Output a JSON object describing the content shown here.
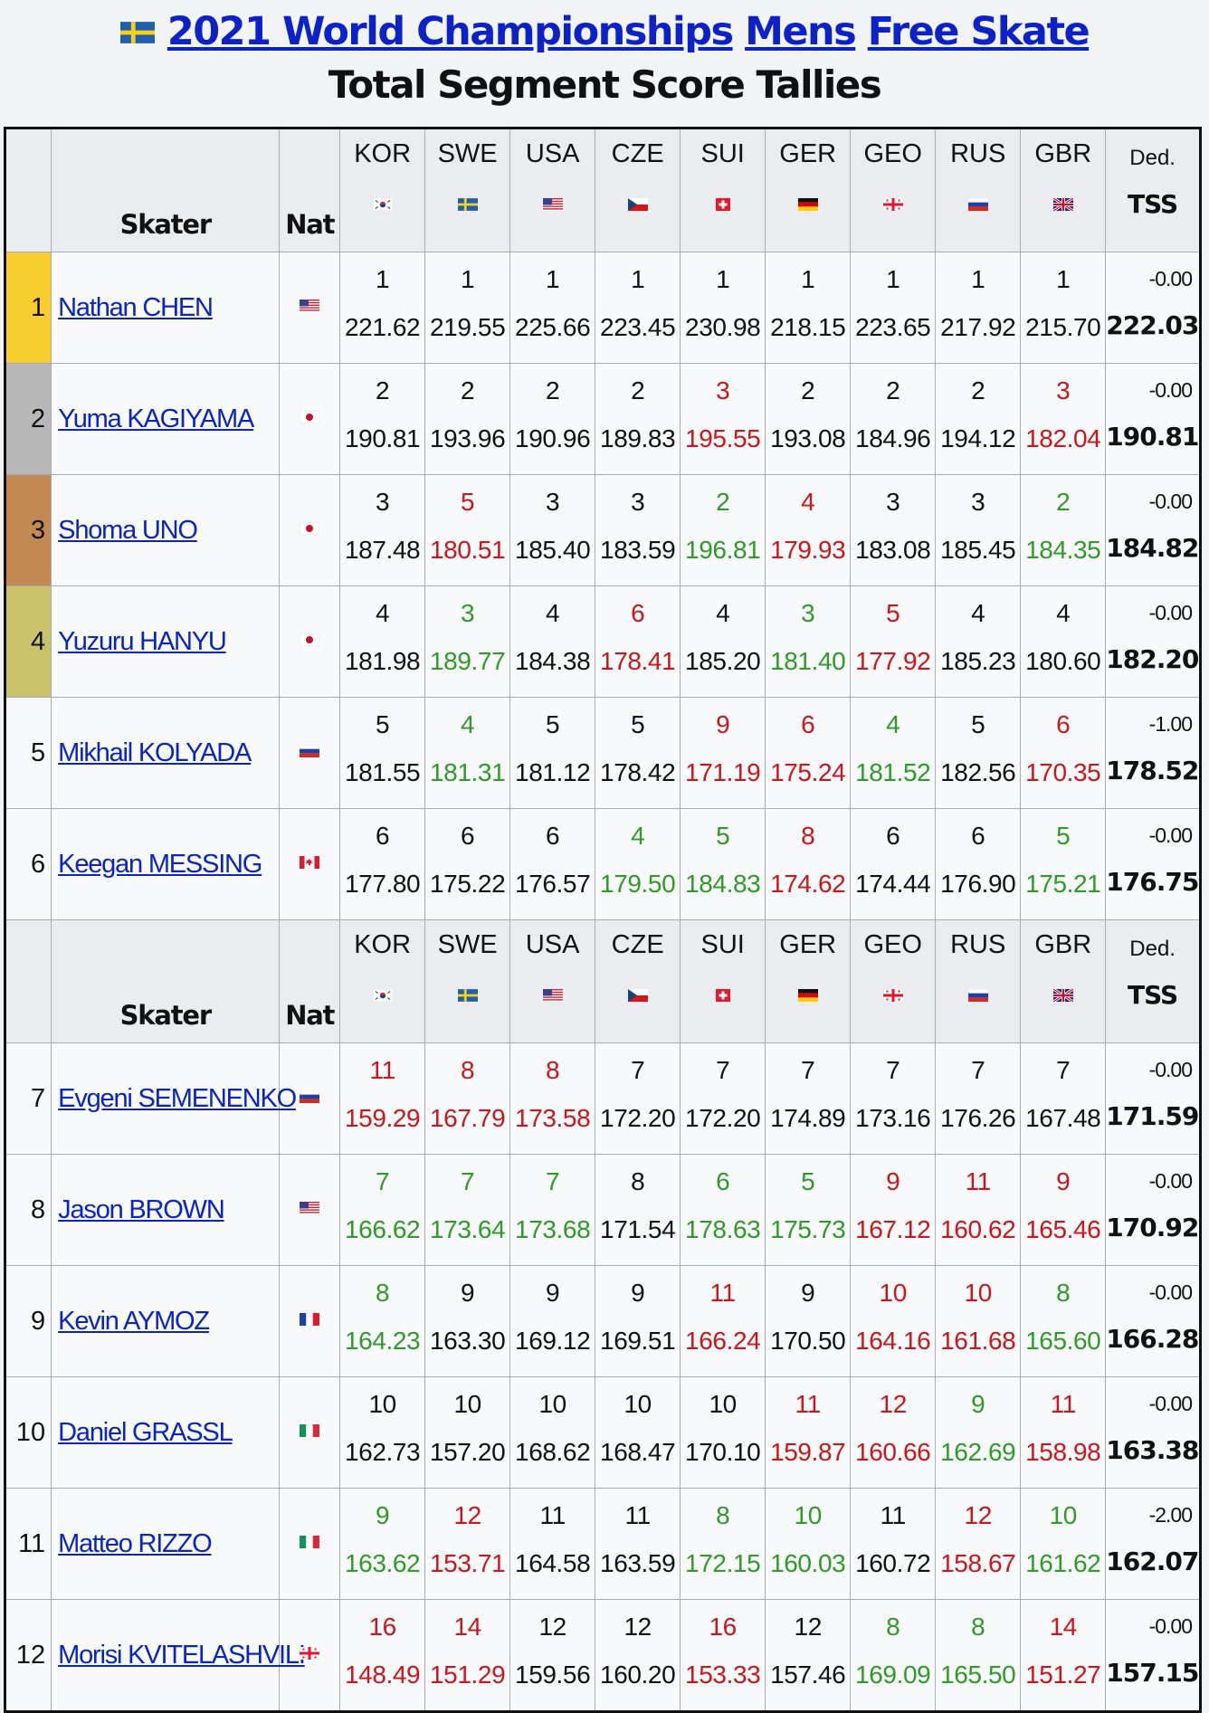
{
  "title": {
    "championship_link": "2021 World Championships",
    "category_link": "Mens",
    "segment_link": "Free Skate",
    "subtitle": "Total Segment Score Tallies",
    "host_flag_icon": "sweden-flag-icon"
  },
  "header": {
    "skater_label": "Skater",
    "nat_label": "Nat",
    "ded_label": "Ded.",
    "tss_label": "TSS",
    "judges": [
      {
        "code": "KOR",
        "flag": "kor"
      },
      {
        "code": "SWE",
        "flag": "swe"
      },
      {
        "code": "USA",
        "flag": "usa"
      },
      {
        "code": "CZE",
        "flag": "cze"
      },
      {
        "code": "SUI",
        "flag": "sui"
      },
      {
        "code": "GER",
        "flag": "ger"
      },
      {
        "code": "GEO",
        "flag": "geo"
      },
      {
        "code": "RUS",
        "flag": "rus"
      },
      {
        "code": "GBR",
        "flag": "gbr"
      }
    ]
  },
  "colors": {
    "link": "#0b22c9",
    "better": "#2f9a27",
    "worse": "#d0141e",
    "gold": "#f8ce2e",
    "silver": "#b8b8b8",
    "bronze": "#c48952",
    "fourth": "#c9c06a"
  },
  "rows": [
    {
      "rank": "1",
      "name": "Nathan CHEN",
      "nat": "usa",
      "ded": "-0.00",
      "tss": "222.03",
      "judges": [
        {
          "place": "1",
          "score": "221.62",
          "dir": ""
        },
        {
          "place": "1",
          "score": "219.55",
          "dir": ""
        },
        {
          "place": "1",
          "score": "225.66",
          "dir": ""
        },
        {
          "place": "1",
          "score": "223.45",
          "dir": ""
        },
        {
          "place": "1",
          "score": "230.98",
          "dir": ""
        },
        {
          "place": "1",
          "score": "218.15",
          "dir": ""
        },
        {
          "place": "1",
          "score": "223.65",
          "dir": ""
        },
        {
          "place": "1",
          "score": "217.92",
          "dir": ""
        },
        {
          "place": "1",
          "score": "215.70",
          "dir": ""
        }
      ]
    },
    {
      "rank": "2",
      "name": "Yuma KAGIYAMA",
      "nat": "jpn",
      "ded": "-0.00",
      "tss": "190.81",
      "judges": [
        {
          "place": "2",
          "score": "190.81",
          "dir": ""
        },
        {
          "place": "2",
          "score": "193.96",
          "dir": ""
        },
        {
          "place": "2",
          "score": "190.96",
          "dir": ""
        },
        {
          "place": "2",
          "score": "189.83",
          "dir": ""
        },
        {
          "place": "3",
          "score": "195.55",
          "dir": "down"
        },
        {
          "place": "2",
          "score": "193.08",
          "dir": ""
        },
        {
          "place": "2",
          "score": "184.96",
          "dir": ""
        },
        {
          "place": "2",
          "score": "194.12",
          "dir": ""
        },
        {
          "place": "3",
          "score": "182.04",
          "dir": "down"
        }
      ]
    },
    {
      "rank": "3",
      "name": "Shoma UNO",
      "nat": "jpn",
      "ded": "-0.00",
      "tss": "184.82",
      "judges": [
        {
          "place": "3",
          "score": "187.48",
          "dir": ""
        },
        {
          "place": "5",
          "score": "180.51",
          "dir": "down"
        },
        {
          "place": "3",
          "score": "185.40",
          "dir": ""
        },
        {
          "place": "3",
          "score": "183.59",
          "dir": ""
        },
        {
          "place": "2",
          "score": "196.81",
          "dir": "up"
        },
        {
          "place": "4",
          "score": "179.93",
          "dir": "down"
        },
        {
          "place": "3",
          "score": "183.08",
          "dir": ""
        },
        {
          "place": "3",
          "score": "185.45",
          "dir": ""
        },
        {
          "place": "2",
          "score": "184.35",
          "dir": "up"
        }
      ]
    },
    {
      "rank": "4",
      "name": "Yuzuru HANYU",
      "nat": "jpn",
      "ded": "-0.00",
      "tss": "182.20",
      "judges": [
        {
          "place": "4",
          "score": "181.98",
          "dir": ""
        },
        {
          "place": "3",
          "score": "189.77",
          "dir": "up"
        },
        {
          "place": "4",
          "score": "184.38",
          "dir": ""
        },
        {
          "place": "6",
          "score": "178.41",
          "dir": "down"
        },
        {
          "place": "4",
          "score": "185.20",
          "dir": ""
        },
        {
          "place": "3",
          "score": "181.40",
          "dir": "up"
        },
        {
          "place": "5",
          "score": "177.92",
          "dir": "down"
        },
        {
          "place": "4",
          "score": "185.23",
          "dir": ""
        },
        {
          "place": "4",
          "score": "180.60",
          "dir": ""
        }
      ]
    },
    {
      "rank": "5",
      "name": "Mikhail KOLYADA",
      "nat": "rus",
      "ded": "-1.00",
      "tss": "178.52",
      "judges": [
        {
          "place": "5",
          "score": "181.55",
          "dir": ""
        },
        {
          "place": "4",
          "score": "181.31",
          "dir": "up"
        },
        {
          "place": "5",
          "score": "181.12",
          "dir": ""
        },
        {
          "place": "5",
          "score": "178.42",
          "dir": ""
        },
        {
          "place": "9",
          "score": "171.19",
          "dir": "down"
        },
        {
          "place": "6",
          "score": "175.24",
          "dir": "down"
        },
        {
          "place": "4",
          "score": "181.52",
          "dir": "up"
        },
        {
          "place": "5",
          "score": "182.56",
          "dir": ""
        },
        {
          "place": "6",
          "score": "170.35",
          "dir": "down"
        }
      ]
    },
    {
      "rank": "6",
      "name": "Keegan MESSING",
      "nat": "can",
      "ded": "-0.00",
      "tss": "176.75",
      "judges": [
        {
          "place": "6",
          "score": "177.80",
          "dir": ""
        },
        {
          "place": "6",
          "score": "175.22",
          "dir": ""
        },
        {
          "place": "6",
          "score": "176.57",
          "dir": ""
        },
        {
          "place": "4",
          "score": "179.50",
          "dir": "up"
        },
        {
          "place": "5",
          "score": "184.83",
          "dir": "up"
        },
        {
          "place": "8",
          "score": "174.62",
          "dir": "down"
        },
        {
          "place": "6",
          "score": "174.44",
          "dir": ""
        },
        {
          "place": "6",
          "score": "176.90",
          "dir": ""
        },
        {
          "place": "5",
          "score": "175.21",
          "dir": "up"
        }
      ]
    },
    {
      "header": true
    },
    {
      "rank": "7",
      "name": "Evgeni SEMENENKO",
      "nat": "rus",
      "ded": "-0.00",
      "tss": "171.59",
      "judges": [
        {
          "place": "11",
          "score": "159.29",
          "dir": "down"
        },
        {
          "place": "8",
          "score": "167.79",
          "dir": "down"
        },
        {
          "place": "8",
          "score": "173.58",
          "dir": "down"
        },
        {
          "place": "7",
          "score": "172.20",
          "dir": ""
        },
        {
          "place": "7",
          "score": "172.20",
          "dir": ""
        },
        {
          "place": "7",
          "score": "174.89",
          "dir": ""
        },
        {
          "place": "7",
          "score": "173.16",
          "dir": ""
        },
        {
          "place": "7",
          "score": "176.26",
          "dir": ""
        },
        {
          "place": "7",
          "score": "167.48",
          "dir": ""
        }
      ]
    },
    {
      "rank": "8",
      "name": "Jason BROWN",
      "nat": "usa",
      "ded": "-0.00",
      "tss": "170.92",
      "judges": [
        {
          "place": "7",
          "score": "166.62",
          "dir": "up"
        },
        {
          "place": "7",
          "score": "173.64",
          "dir": "up"
        },
        {
          "place": "7",
          "score": "173.68",
          "dir": "up"
        },
        {
          "place": "8",
          "score": "171.54",
          "dir": ""
        },
        {
          "place": "6",
          "score": "178.63",
          "dir": "up"
        },
        {
          "place": "5",
          "score": "175.73",
          "dir": "up"
        },
        {
          "place": "9",
          "score": "167.12",
          "dir": "down"
        },
        {
          "place": "11",
          "score": "160.62",
          "dir": "down"
        },
        {
          "place": "9",
          "score": "165.46",
          "dir": "down"
        }
      ]
    },
    {
      "rank": "9",
      "name": "Kevin AYMOZ",
      "nat": "fra",
      "ded": "-0.00",
      "tss": "166.28",
      "judges": [
        {
          "place": "8",
          "score": "164.23",
          "dir": "up"
        },
        {
          "place": "9",
          "score": "163.30",
          "dir": ""
        },
        {
          "place": "9",
          "score": "169.12",
          "dir": ""
        },
        {
          "place": "9",
          "score": "169.51",
          "dir": ""
        },
        {
          "place": "11",
          "score": "166.24",
          "dir": "down"
        },
        {
          "place": "9",
          "score": "170.50",
          "dir": ""
        },
        {
          "place": "10",
          "score": "164.16",
          "dir": "down"
        },
        {
          "place": "10",
          "score": "161.68",
          "dir": "down"
        },
        {
          "place": "8",
          "score": "165.60",
          "dir": "up"
        }
      ]
    },
    {
      "rank": "10",
      "name": "Daniel GRASSL",
      "nat": "ita",
      "ded": "-0.00",
      "tss": "163.38",
      "judges": [
        {
          "place": "10",
          "score": "162.73",
          "dir": ""
        },
        {
          "place": "10",
          "score": "157.20",
          "dir": ""
        },
        {
          "place": "10",
          "score": "168.62",
          "dir": ""
        },
        {
          "place": "10",
          "score": "168.47",
          "dir": ""
        },
        {
          "place": "10",
          "score": "170.10",
          "dir": ""
        },
        {
          "place": "11",
          "score": "159.87",
          "dir": "down"
        },
        {
          "place": "12",
          "score": "160.66",
          "dir": "down"
        },
        {
          "place": "9",
          "score": "162.69",
          "dir": "up"
        },
        {
          "place": "11",
          "score": "158.98",
          "dir": "down"
        }
      ]
    },
    {
      "rank": "11",
      "name": "Matteo RIZZO",
      "nat": "ita",
      "ded": "-2.00",
      "tss": "162.07",
      "judges": [
        {
          "place": "9",
          "score": "163.62",
          "dir": "up"
        },
        {
          "place": "12",
          "score": "153.71",
          "dir": "down"
        },
        {
          "place": "11",
          "score": "164.58",
          "dir": ""
        },
        {
          "place": "11",
          "score": "163.59",
          "dir": ""
        },
        {
          "place": "8",
          "score": "172.15",
          "dir": "up"
        },
        {
          "place": "10",
          "score": "160.03",
          "dir": "up"
        },
        {
          "place": "11",
          "score": "160.72",
          "dir": ""
        },
        {
          "place": "12",
          "score": "158.67",
          "dir": "down"
        },
        {
          "place": "10",
          "score": "161.62",
          "dir": "up"
        }
      ]
    },
    {
      "rank": "12",
      "name": "Morisi KVITELASHVILI",
      "nat": "geo",
      "ded": "-0.00",
      "tss": "157.15",
      "judges": [
        {
          "place": "16",
          "score": "148.49",
          "dir": "down"
        },
        {
          "place": "14",
          "score": "151.29",
          "dir": "down"
        },
        {
          "place": "12",
          "score": "159.56",
          "dir": ""
        },
        {
          "place": "12",
          "score": "160.20",
          "dir": ""
        },
        {
          "place": "16",
          "score": "153.33",
          "dir": "down"
        },
        {
          "place": "12",
          "score": "157.46",
          "dir": ""
        },
        {
          "place": "8",
          "score": "169.09",
          "dir": "up"
        },
        {
          "place": "8",
          "score": "165.50",
          "dir": "up"
        },
        {
          "place": "14",
          "score": "151.27",
          "dir": "down"
        }
      ]
    }
  ]
}
